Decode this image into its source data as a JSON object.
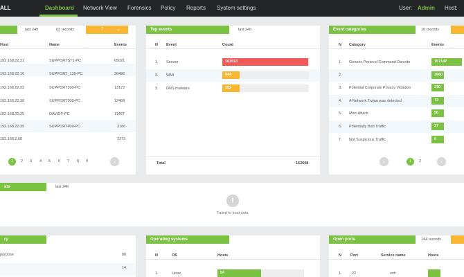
{
  "header": {
    "brand": "ALL",
    "nav": [
      "Dashboard",
      "Network View",
      "Forensics",
      "Policy",
      "Reports",
      "System settings"
    ],
    "user_label": "User:",
    "user_name": "Admin",
    "host_label": "Host:"
  },
  "top_hosts": {
    "period": "last 24h",
    "records": "63 records",
    "filter_value": "7",
    "columns": [
      "Host",
      "Name",
      "Events"
    ],
    "rows": [
      [
        "192.168.22.21",
        "SUPPORTST1-PC",
        "65021"
      ],
      [
        "192.168.22.16",
        "SUPPORT_139-PC",
        "26496"
      ],
      [
        "192.168.22.23",
        "SUPPORT200-PC",
        "13172"
      ],
      [
        "192.168.22.38",
        "SUPPORT300-PC",
        "12468"
      ],
      [
        "192.168.20.25",
        "DAVIDP-PC",
        "11467"
      ],
      [
        "192.168.22.39",
        "SUPPORT400-PC",
        "3186"
      ],
      [
        "192.168.2.60",
        "",
        "2373"
      ]
    ],
    "pages": [
      "1",
      "2",
      "3",
      "4",
      "5",
      "6",
      "7",
      "8",
      "9"
    ]
  },
  "top_events": {
    "title": "Top events",
    "period": "last 24h",
    "columns": [
      "N",
      "Event",
      "Count"
    ],
    "rows": [
      {
        "n": "1.",
        "event": "Sensor",
        "count": "161513",
        "color": "#f25a5a",
        "fraction": 0.994
      },
      {
        "n": "2.",
        "event": "WMI",
        "count": "944",
        "color": "#f8b632",
        "fraction": 0.2
      },
      {
        "n": "3.",
        "event": "DNS malware",
        "count": "152",
        "color": "#f8b632",
        "fraction": 0.2
      }
    ],
    "total_label": "Total",
    "total_value": "162608"
  },
  "event_categories": {
    "title": "Event categories",
    "records": "10 records",
    "columns": [
      "N",
      "Category",
      "Events"
    ],
    "rows": [
      {
        "n": "1.",
        "category": "Generic Protocol Command Decode",
        "events": "157142",
        "fraction": 1.0
      },
      {
        "n": "2.",
        "category": "",
        "events": "3960",
        "fraction": 0.4
      },
      {
        "n": "3.",
        "category": "Potential Corporate Privacy Violation",
        "events": "230",
        "fraction": 0.4
      },
      {
        "n": "4.",
        "category": "A Network Trojan was detected",
        "events": "73",
        "fraction": 0.4
      },
      {
        "n": "5.",
        "category": "Misc Attack",
        "events": "56",
        "fraction": 0.4
      },
      {
        "n": "6.",
        "category": "Potentially Bad Traffic",
        "events": "27",
        "fraction": 0.4
      },
      {
        "n": "7.",
        "category": "Not Suspicious Traffic",
        "events": "6",
        "fraction": 0.4
      }
    ],
    "pages": [
      "1",
      "2"
    ]
  },
  "middle_panel": {
    "title_fragment": "ats",
    "period": "last 24h",
    "error_text": "Failed to load data"
  },
  "bottom_left": {
    "title_fragment": "ry",
    "rows": [
      [
        "purpose",
        "80"
      ],
      [
        "",
        "14"
      ]
    ]
  },
  "operating_systems": {
    "title": "Operating systems",
    "columns": [
      "N",
      "OS",
      "Hosts"
    ],
    "rows": [
      {
        "n": "1.",
        "os": "Linux",
        "hosts": "54",
        "fraction": 0.5
      }
    ]
  },
  "open_ports": {
    "title": "Open ports",
    "records": "144 records",
    "columns": [
      "N",
      "Port",
      "Service name",
      "Hosts"
    ],
    "rows": [
      {
        "n": "1.",
        "port": "22",
        "service": "ssh",
        "hosts": "",
        "fraction": 0.4
      }
    ]
  },
  "colors": {
    "green": "#7cc242",
    "orange": "#f8b632",
    "red": "#f25a5a",
    "dark": "#242526"
  }
}
